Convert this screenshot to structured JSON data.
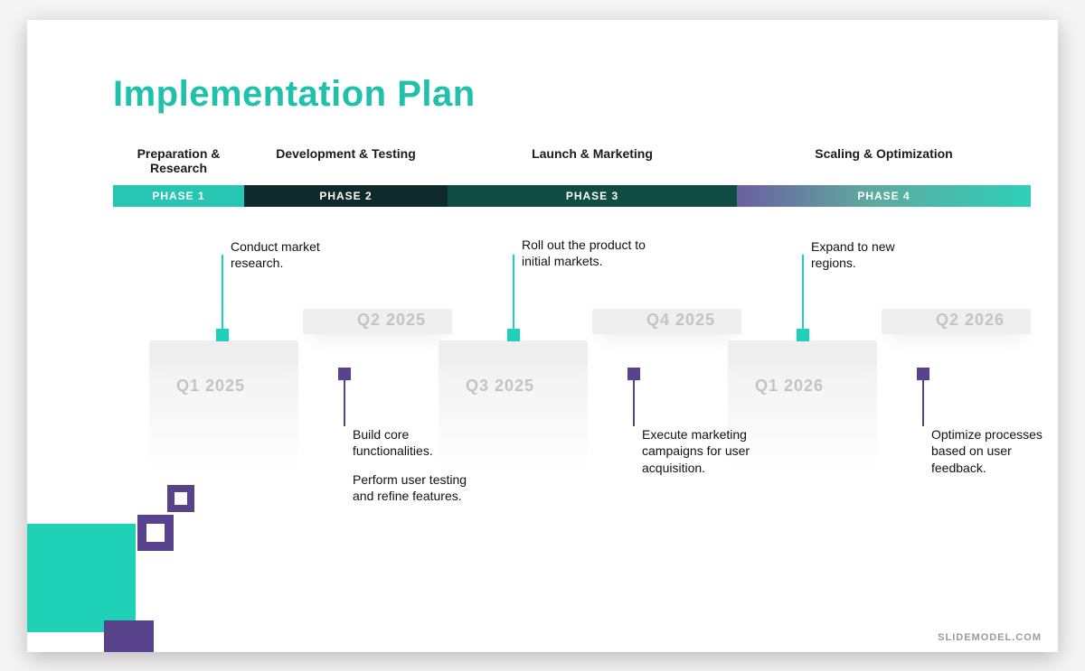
{
  "title": "Implementation Plan",
  "phases": [
    {
      "label": "Preparation & Research",
      "tag": "PHASE 1"
    },
    {
      "label": "Development & Testing",
      "tag": "PHASE 2"
    },
    {
      "label": "Launch & Marketing",
      "tag": "PHASE 3"
    },
    {
      "label": "Scaling & Optimization",
      "tag": "PHASE 4"
    }
  ],
  "quarters": {
    "q1": "Q1 2025",
    "q2": "Q2 2025",
    "q3": "Q3 2025",
    "q4": "Q4 2025",
    "q5": "Q1 2026",
    "q6": "Q2 2026"
  },
  "notes": {
    "n1": "Conduct market research.",
    "n2a": "Build core functionalities.",
    "n2b": "Perform user testing and refine features.",
    "n3": "Roll out the product to initial markets.",
    "n4": "Execute marketing campaigns for user acquisition.",
    "n5": "Expand to new regions.",
    "n6": "Optimize processes based on user feedback."
  },
  "footer": "SLIDEMODEL.COM",
  "colors": {
    "teal": "#1fd1b7",
    "purple": "#59428c",
    "darkteal": "#0f4d42"
  }
}
